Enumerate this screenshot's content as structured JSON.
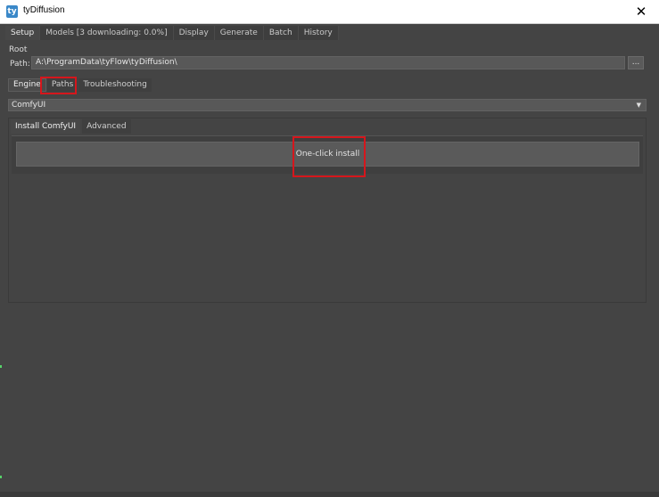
{
  "window": {
    "title": "tyDiffusion",
    "close_label": "✕",
    "app_icon": "ty"
  },
  "top_tabs": [
    {
      "label": "Setup",
      "active": true
    },
    {
      "label": "Models [3 downloading: 0.0%]"
    },
    {
      "label": "Display"
    },
    {
      "label": "Generate"
    },
    {
      "label": "Batch"
    },
    {
      "label": "History"
    }
  ],
  "root": {
    "label": "Root",
    "path_label": "Path:",
    "path_value": "A:\\ProgramData\\tyFlow\\tyDiffusion\\",
    "browse_label": "..."
  },
  "engine_tabs": [
    {
      "label": "Engine",
      "active": true
    },
    {
      "label": "Paths"
    },
    {
      "label": "Troubleshooting"
    }
  ],
  "engine_select": {
    "value": "ComfyUI",
    "arrow": "▼"
  },
  "install_tabs": [
    {
      "label": "Install ComfyUI",
      "active": true
    },
    {
      "label": "Advanced"
    }
  ],
  "install": {
    "button_label": "One-click install"
  },
  "colors": {
    "highlight": "#d6161c",
    "panel": "#444444",
    "field": "#585858"
  }
}
